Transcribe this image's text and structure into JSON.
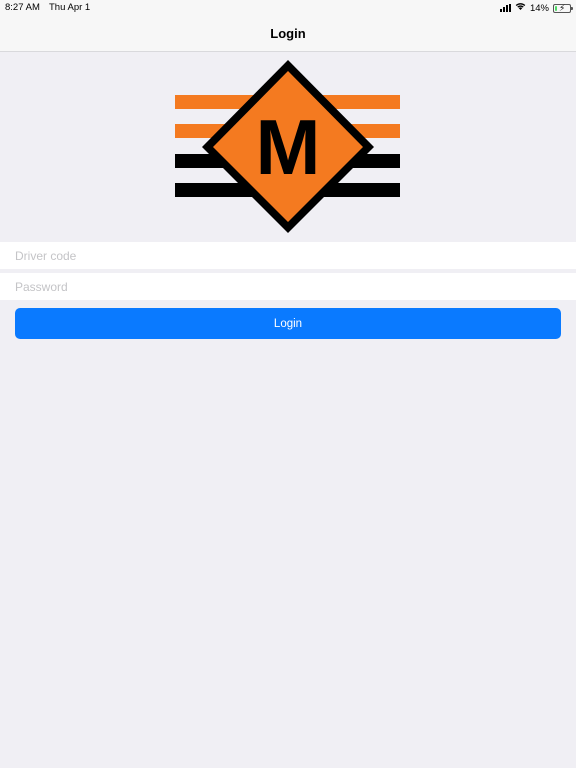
{
  "status_bar": {
    "time": "8:27 AM",
    "date": "Thu Apr 1",
    "battery_percent": "14%",
    "battery_level": 0.14,
    "icons": [
      "signal-icon",
      "wifi-icon",
      "battery-charging-icon"
    ]
  },
  "nav": {
    "title": "Login"
  },
  "logo": {
    "letter": "M",
    "colors": {
      "orange": "#f47a20",
      "black": "#000000"
    }
  },
  "form": {
    "driver_code_placeholder": "Driver code",
    "driver_code_value": "",
    "password_placeholder": "Password",
    "password_value": "",
    "login_label": "Login"
  },
  "colors": {
    "accent": "#0a7aff",
    "background": "#f0eff4"
  }
}
